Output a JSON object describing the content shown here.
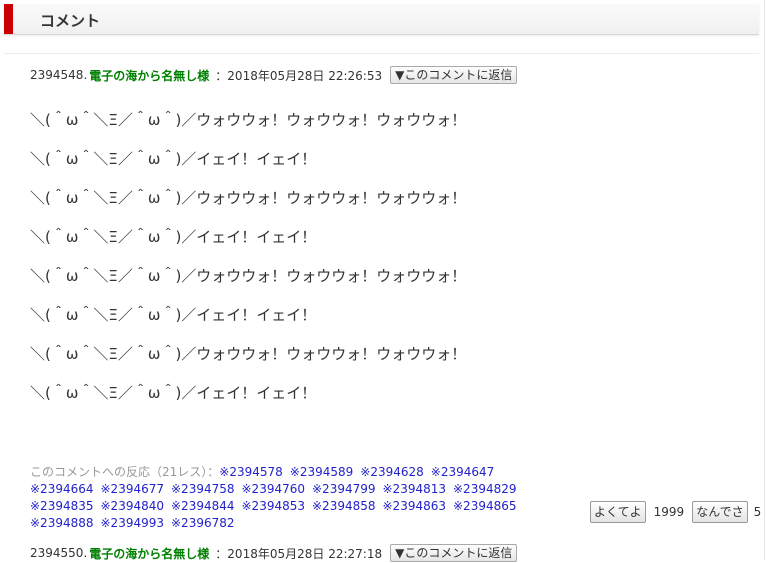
{
  "header": {
    "title": "コメント"
  },
  "comments": [
    {
      "number": "2394548.",
      "author": "電子の海から名無し様",
      "sep": "：",
      "date": "2018年05月28日 22:26:53",
      "reply_label": "▼このコメントに返信",
      "lines": [
        "＼(＾ω＾＼Ξ／＾ω＾)／ウォウウォ！ウォウウォ！ウォウウォ！",
        "＼(＾ω＾＼Ξ／＾ω＾)／イェイ！イェイ！",
        "＼(＾ω＾＼Ξ／＾ω＾)／ウォウウォ！ウォウウォ！ウォウウォ！",
        "＼(＾ω＾＼Ξ／＾ω＾)／イェイ！イェイ！",
        "＼(＾ω＾＼Ξ／＾ω＾)／ウォウウォ！ウォウウォ！ウォウウォ！",
        "＼(＾ω＾＼Ξ／＾ω＾)／イェイ！イェイ！",
        "＼(＾ω＾＼Ξ／＾ω＾)／ウォウウォ！ウォウウォ！ウォウウォ！",
        "＼(＾ω＾＼Ξ／＾ω＾)／イェイ！イェイ！"
      ],
      "reactions_label": "このコメントへの反応（21レス）：",
      "reactions": [
        "※2394578",
        "※2394589",
        "※2394628",
        "※2394647",
        "※2394664",
        "※2394677",
        "※2394758",
        "※2394760",
        "※2394799",
        "※2394813",
        "※2394829",
        "※2394835",
        "※2394840",
        "※2394844",
        "※2394853",
        "※2394858",
        "※2394863",
        "※2394865",
        "※2394888",
        "※2394993",
        "※2396782"
      ],
      "good_label": "よくてよ",
      "good_count": "1999",
      "what_label": "なんでさ",
      "what_count": "5"
    },
    {
      "number": "2394550.",
      "author": "電子の海から名無し様",
      "sep": "：",
      "date": "2018年05月28日 22:27:18",
      "reply_label": "▼このコメントに返信"
    }
  ]
}
